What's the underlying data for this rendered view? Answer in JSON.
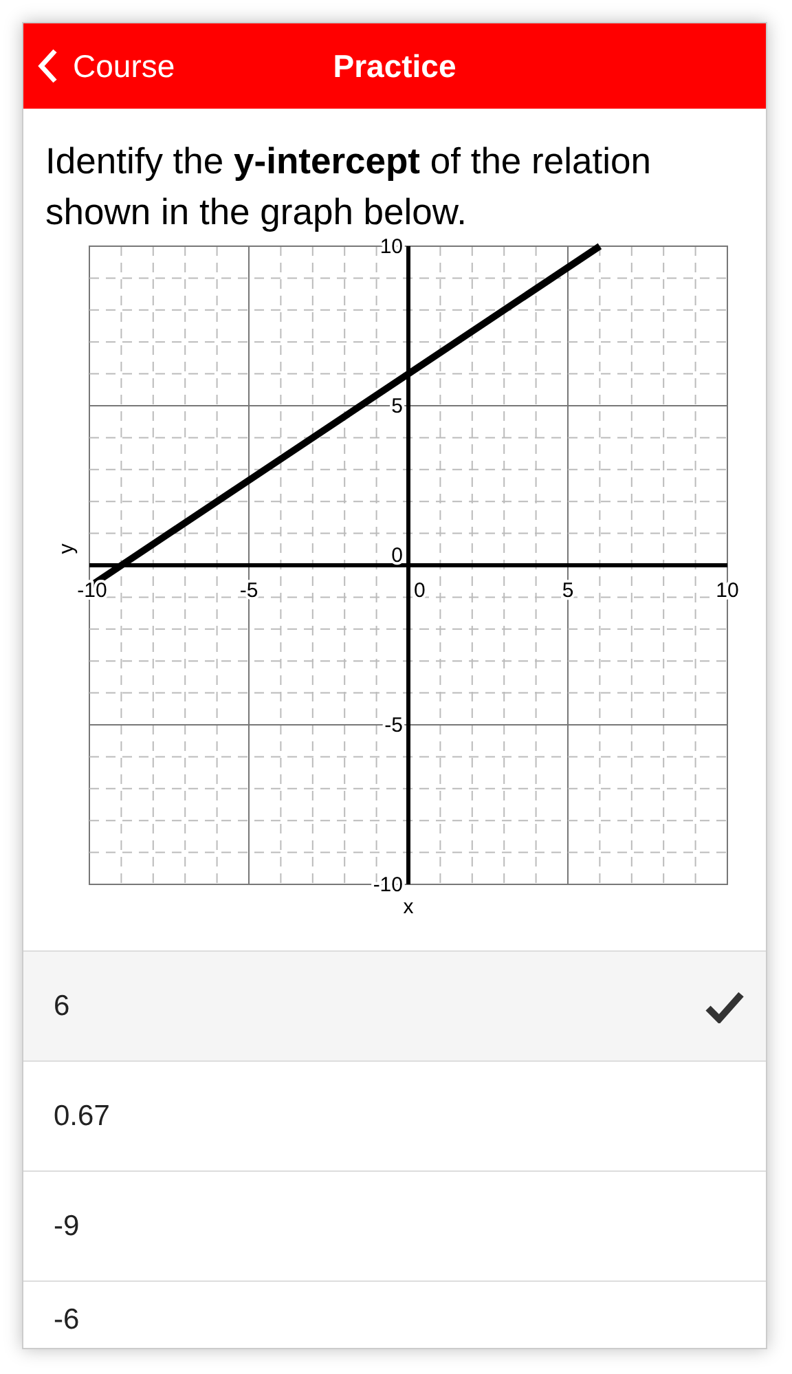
{
  "nav_bar": {
    "back_label": "Course",
    "title": "Practice"
  },
  "question": "Identify the **y-intercept** of the relation shown in the graph below.",
  "graph": {
    "chart_data": {
      "type": "line",
      "xlabel": "x",
      "ylabel": "y",
      "x": [
        -10,
        6
      ],
      "series": [
        {
          "color": "#000000",
          "values": [
            -0.67,
            10
          ]
        }
      ],
      "grid": true,
      "xlim": [
        -10,
        10
      ],
      "ylim": [
        -10,
        10
      ],
      "xticks": [
        -10,
        -5,
        0,
        5,
        10
      ],
      "yticks": [
        -10,
        -5,
        0,
        5,
        10
      ]
    }
  },
  "options": [
    {
      "label": "6",
      "selected": true
    },
    {
      "label": "0.67",
      "selected": false
    },
    {
      "label": "-9",
      "selected": false
    },
    {
      "label": "-6",
      "selected": false
    }
  ]
}
